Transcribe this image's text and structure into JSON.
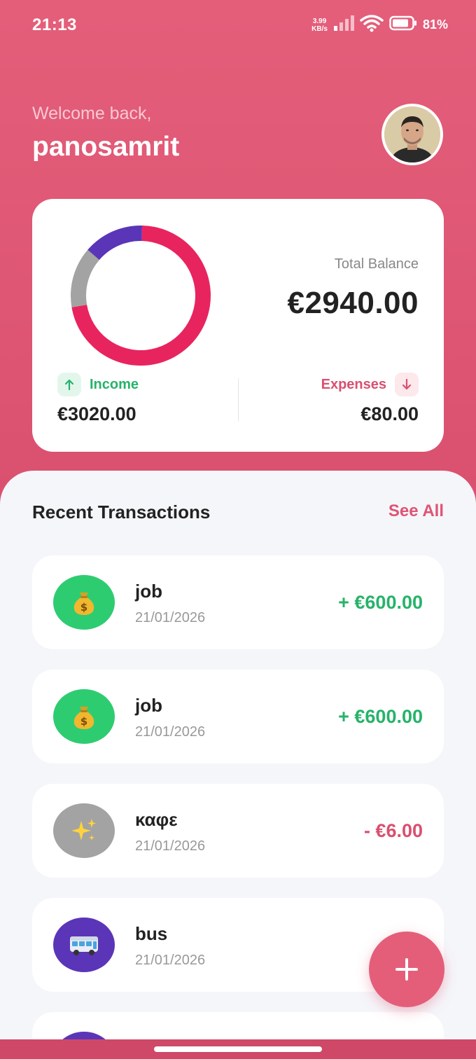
{
  "status_bar": {
    "time": "21:13",
    "net_speed_value": "3.99",
    "net_speed_unit": "KB/s",
    "battery_percent": "81%",
    "icons": [
      "signal-icon",
      "wifi-icon",
      "battery-icon"
    ]
  },
  "header": {
    "welcome": "Welcome back,",
    "username": "panosamrit"
  },
  "balance": {
    "total_label": "Total Balance",
    "total_value": "€2940.00",
    "income_label": "Income",
    "income_value": "€3020.00",
    "expenses_label": "Expenses",
    "expenses_value": "€80.00"
  },
  "chart_data": {
    "type": "pie",
    "style": "donut",
    "colors": [
      "#e8245e",
      "#a3a3a3",
      "#5a35b8"
    ]
  },
  "recent": {
    "title": "Recent Transactions",
    "see_all": "See All"
  },
  "transactions": [
    {
      "title": "job",
      "date": "21/01/2026",
      "amount": "+ €600.00",
      "icon": "money-bag-icon",
      "icon_bg": "#2ecc71",
      "amount_color": "#26b36a"
    },
    {
      "title": "job",
      "date": "21/01/2026",
      "amount": "+ €600.00",
      "icon": "money-bag-icon",
      "icon_bg": "#2ecc71",
      "amount_color": "#26b36a"
    },
    {
      "title": "καφε",
      "date": "21/01/2026",
      "amount": "- €6.00",
      "icon": "sparkles-icon",
      "icon_bg": "#a3a3a3",
      "amount_color": "#d9506f"
    },
    {
      "title": "bus",
      "date": "21/01/2026",
      "amount": "- €",
      "icon": "bus-icon",
      "icon_bg": "#5a35b8",
      "amount_color": "#d9506f"
    }
  ],
  "colors": {
    "primary": "#e45e7a",
    "income": "#26b36a",
    "expense": "#d9506f"
  }
}
